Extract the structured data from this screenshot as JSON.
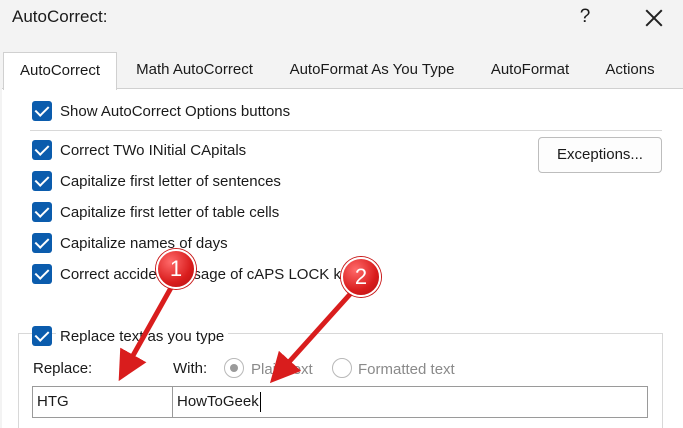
{
  "window": {
    "title": "AutoCorrect:",
    "help_icon": "?"
  },
  "tabs": [
    {
      "label": "AutoCorrect",
      "active": true
    },
    {
      "label": "Math AutoCorrect",
      "active": false
    },
    {
      "label": "AutoFormat As You Type",
      "active": false
    },
    {
      "label": "AutoFormat",
      "active": false
    },
    {
      "label": "Actions",
      "active": false
    }
  ],
  "options": {
    "show_buttons": {
      "label": "Show AutoCorrect Options buttons",
      "checked": true
    },
    "two_initials": {
      "label": "Correct TWo INitial CApitals",
      "checked": true
    },
    "first_letter_sentences": {
      "label": "Capitalize first letter of sentences",
      "checked": true
    },
    "first_letter_table": {
      "label": "Capitalize first letter of table cells",
      "checked": true
    },
    "names_of_days": {
      "label": "Capitalize names of days",
      "checked": true
    },
    "caps_lock": {
      "label": "Correct accidental usage of cAPS LOCK key",
      "checked": true
    },
    "replace_text": {
      "label": "Replace text as you type",
      "checked": true
    }
  },
  "exceptions_button": "Exceptions...",
  "replace": {
    "replace_label": "Replace:",
    "with_label": "With:",
    "plain_text_label": "Plain text",
    "formatted_text_label": "Formatted text",
    "plain_text_selected": true,
    "replace_value": "HTG",
    "with_value": "HowToGeek"
  },
  "annotations": {
    "marker_1": "1",
    "marker_2": "2",
    "color": "#d91d1d"
  }
}
